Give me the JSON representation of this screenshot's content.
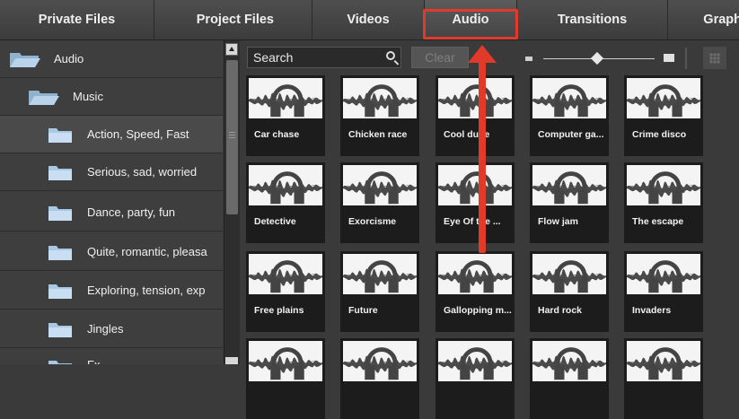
{
  "tabs": [
    {
      "label": "Private Files"
    },
    {
      "label": "Project Files"
    },
    {
      "label": "Videos"
    },
    {
      "label": "Audio"
    },
    {
      "label": "Transitions"
    },
    {
      "label": "Graph"
    }
  ],
  "sidebar": {
    "items": [
      {
        "label": "Audio",
        "icon": "folder-open-icon"
      },
      {
        "label": "Music",
        "icon": "folder-open-icon"
      },
      {
        "label": "Action, Speed, Fast",
        "icon": "folder-icon"
      },
      {
        "label": "Serious, sad, worried",
        "icon": "folder-icon"
      },
      {
        "label": "Dance, party, fun",
        "icon": "folder-icon"
      },
      {
        "label": "Quite, romantic, pleasa",
        "icon": "folder-icon"
      },
      {
        "label": "Exploring, tension, exp",
        "icon": "folder-icon"
      },
      {
        "label": "Jingles",
        "icon": "folder-icon"
      },
      {
        "label": "Fx",
        "icon": "folder-icon"
      }
    ]
  },
  "toolbar": {
    "search_label": "Search",
    "clear_label": "Clear"
  },
  "tiles": [
    {
      "label": "Car chase"
    },
    {
      "label": "Chicken race"
    },
    {
      "label": "Cool dude"
    },
    {
      "label": "Computer ga..."
    },
    {
      "label": "Crime disco"
    },
    {
      "label": "Detective"
    },
    {
      "label": "Exorcisme"
    },
    {
      "label": "Eye Of the ..."
    },
    {
      "label": "Flow jam"
    },
    {
      "label": "The escape"
    },
    {
      "label": "Free plains"
    },
    {
      "label": "Future"
    },
    {
      "label": "Gallopping m..."
    },
    {
      "label": "Hard rock"
    },
    {
      "label": "Invaders"
    },
    {
      "label": ""
    },
    {
      "label": ""
    },
    {
      "label": ""
    },
    {
      "label": ""
    },
    {
      "label": ""
    }
  ],
  "colors": {
    "highlight": "#e03a2a",
    "panel": "#3a3a3a",
    "tile": "#1c1c1c"
  }
}
